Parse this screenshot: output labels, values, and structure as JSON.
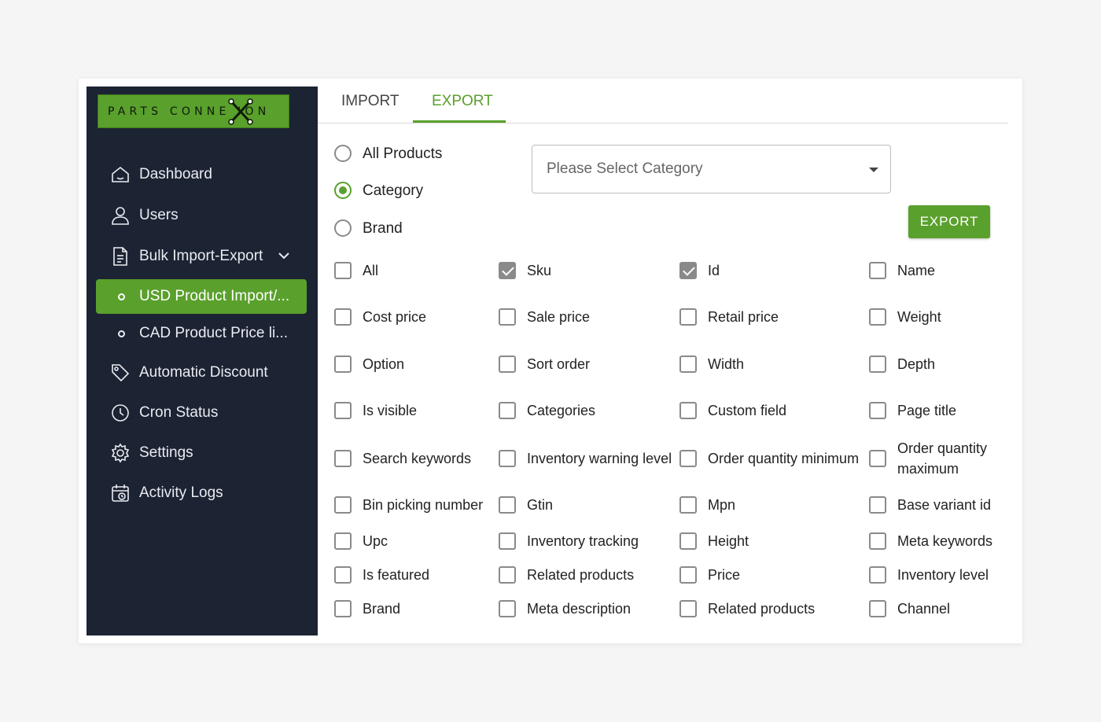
{
  "app": {
    "logo_text": "PARTS CONNE    ION"
  },
  "sidebar": {
    "items": [
      {
        "label": "Dashboard",
        "icon": "home-icon"
      },
      {
        "label": "Users",
        "icon": "user-icon"
      },
      {
        "label": "Bulk Import-Export",
        "icon": "document-icon"
      },
      {
        "label": "Automatic Discount",
        "icon": "tag-icon"
      },
      {
        "label": "Cron Status",
        "icon": "clock-icon"
      },
      {
        "label": "Settings",
        "icon": "gear-icon"
      },
      {
        "label": "Activity Logs",
        "icon": "calendar-log-icon"
      }
    ],
    "subitems": [
      {
        "label": "USD Product Import/..."
      },
      {
        "label": "CAD Product Price li..."
      }
    ]
  },
  "tabs": [
    {
      "label": "IMPORT"
    },
    {
      "label": "EXPORT"
    }
  ],
  "scope": {
    "options": [
      {
        "label": "All Products",
        "selected": false
      },
      {
        "label": "Category",
        "selected": true
      },
      {
        "label": "Brand",
        "selected": false
      }
    ]
  },
  "category_select": {
    "placeholder": "Please Select Category"
  },
  "export_button": {
    "label": "EXPORT"
  },
  "fields": [
    {
      "label": "All",
      "checked": false
    },
    {
      "label": "Sku",
      "checked": true
    },
    {
      "label": "Id",
      "checked": true
    },
    {
      "label": "Name",
      "checked": false
    },
    {
      "label": "Cost price",
      "checked": false
    },
    {
      "label": "Sale price",
      "checked": false
    },
    {
      "label": "Retail price",
      "checked": false
    },
    {
      "label": "Weight",
      "checked": false
    },
    {
      "label": "Option",
      "checked": false
    },
    {
      "label": "Sort order",
      "checked": false
    },
    {
      "label": "Width",
      "checked": false
    },
    {
      "label": "Depth",
      "checked": false
    },
    {
      "label": "Is visible",
      "checked": false
    },
    {
      "label": "Categories",
      "checked": false
    },
    {
      "label": "Custom field",
      "checked": false
    },
    {
      "label": "Page title",
      "checked": false
    },
    {
      "label": "Search keywords",
      "checked": false
    },
    {
      "label": "Inventory warning level",
      "checked": false
    },
    {
      "label": "Order quantity minimum",
      "checked": false
    },
    {
      "label": "Order quantity maximum",
      "checked": false
    },
    {
      "label": "Bin picking number",
      "checked": false
    },
    {
      "label": "Gtin",
      "checked": false
    },
    {
      "label": "Mpn",
      "checked": false
    },
    {
      "label": "Base variant id",
      "checked": false
    },
    {
      "label": "Upc",
      "checked": false
    },
    {
      "label": "Inventory tracking",
      "checked": false
    },
    {
      "label": "Height",
      "checked": false
    },
    {
      "label": "Meta keywords",
      "checked": false
    },
    {
      "label": "Is featured",
      "checked": false
    },
    {
      "label": "Related products",
      "checked": false
    },
    {
      "label": "Price",
      "checked": false
    },
    {
      "label": "Inventory level",
      "checked": false
    },
    {
      "label": "Brand",
      "checked": false
    },
    {
      "label": "Meta description",
      "checked": false
    },
    {
      "label": "Related products",
      "checked": false
    },
    {
      "label": "Channel",
      "checked": false
    }
  ],
  "colors": {
    "accent": "#5aa02c",
    "sidebar_bg": "#1c2333"
  }
}
